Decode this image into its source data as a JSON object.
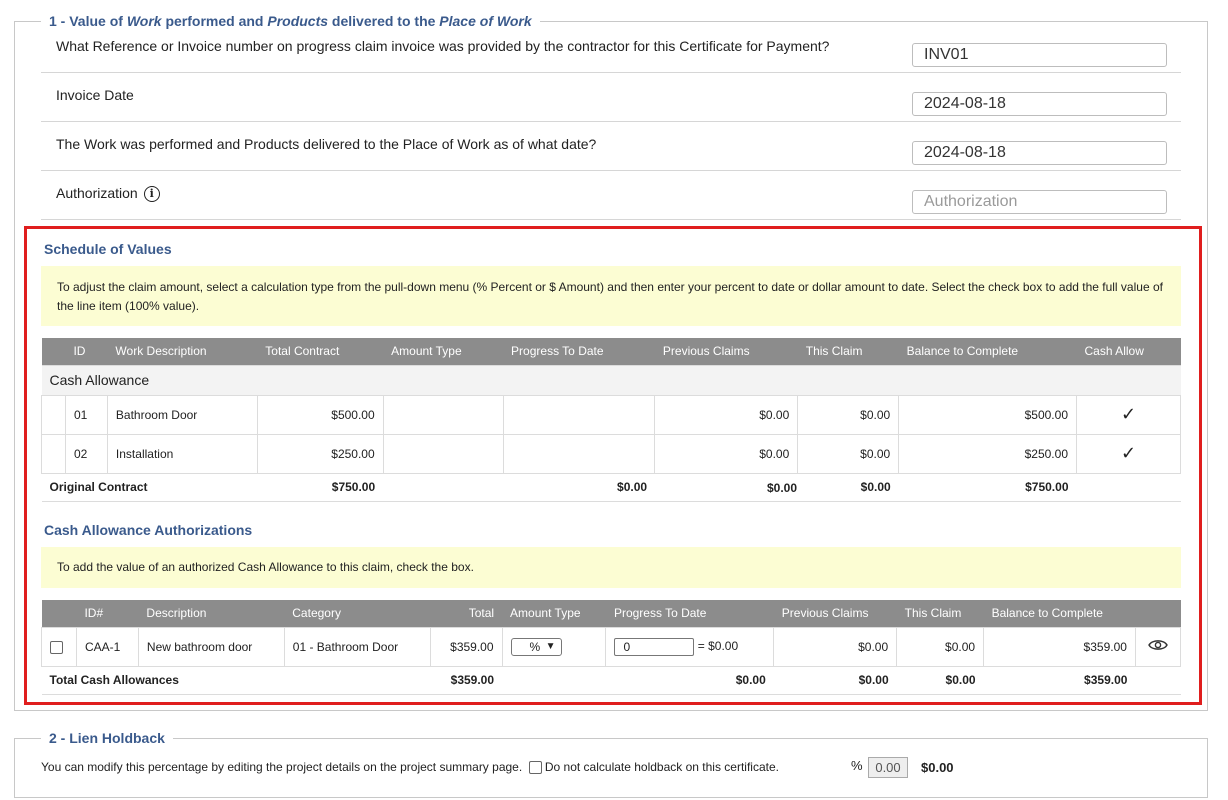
{
  "section1": {
    "legend_pre": "1 - Value of ",
    "legend_work": "Work",
    "legend_mid": " performed and ",
    "legend_products": "Products",
    "legend_mid2": " delivered to the ",
    "legend_place": "Place of Work"
  },
  "questions": [
    {
      "label": "What Reference or Invoice number on progress claim invoice was provided by the contractor for this Certificate for Payment?",
      "value": "INV01"
    },
    {
      "label": "Invoice Date",
      "value": "2024-08-18"
    },
    {
      "label": "The Work was performed and Products delivered to the Place of Work as of what date?",
      "value": "2024-08-18"
    },
    {
      "label": "Authorization",
      "placeholder": "Authorization"
    }
  ],
  "sov": {
    "title": "Schedule of Values",
    "note": "To adjust the claim amount, select a calculation type from the pull-down menu (% Percent or $ Amount) and then enter your percent to date or dollar amount to date. Select the check box to add the full value of the line item (100% value).",
    "headers": [
      "ID",
      "Work Description",
      "Total Contract",
      "Amount Type",
      "Progress To Date",
      "Previous Claims",
      "This Claim",
      "Balance to Complete",
      "Cash Allow"
    ],
    "group": "Cash Allowance",
    "rows": [
      {
        "id": "01",
        "desc": "Bathroom Door",
        "total": "$500.00",
        "prev": "$0.00",
        "this": "$0.00",
        "balance": "$500.00"
      },
      {
        "id": "02",
        "desc": "Installation",
        "total": "$250.00",
        "prev": "$0.00",
        "this": "$0.00",
        "balance": "$250.00"
      }
    ],
    "totals": {
      "label": "Original Contract",
      "total": "$750.00",
      "progress": "$0.00",
      "prev": "$0.00",
      "this": "$0.00",
      "balance": "$750.00"
    }
  },
  "caa": {
    "title": "Cash Allowance Authorizations",
    "note": "To add the value of an authorized Cash Allowance to this claim, check the box.",
    "headers": [
      "ID#",
      "Description",
      "Category",
      "Total",
      "Amount Type",
      "Progress To Date",
      "Previous Claims",
      "This Claim",
      "Balance to Complete"
    ],
    "row": {
      "id": "CAA-1",
      "desc": "New bathroom door",
      "category": "01 - Bathroom Door",
      "total": "$359.00",
      "amount_type": "%",
      "progress_value": "0",
      "progress_calc": "= $0.00",
      "prev": "$0.00",
      "this": "$0.00",
      "balance": "$359.00"
    },
    "totals": {
      "label": "Total Cash Allowances",
      "total": "$359.00",
      "progress": "$0.00",
      "prev": "$0.00",
      "this": "$0.00",
      "balance": "$359.00"
    }
  },
  "section2": {
    "legend": "2 - Lien Holdback",
    "text": "You can modify this percentage by editing the project details on the project summary page.",
    "checkbox_label": "Do not calculate holdback on this certificate.",
    "pct_symbol": "%",
    "pct_value": "0.00",
    "amount": "$0.00"
  },
  "colors": {
    "legend": "#3a5a8c",
    "highlight": "#e01e1e",
    "note_bg": "#fcfdd3",
    "header_bg": "#8c8c8c"
  }
}
